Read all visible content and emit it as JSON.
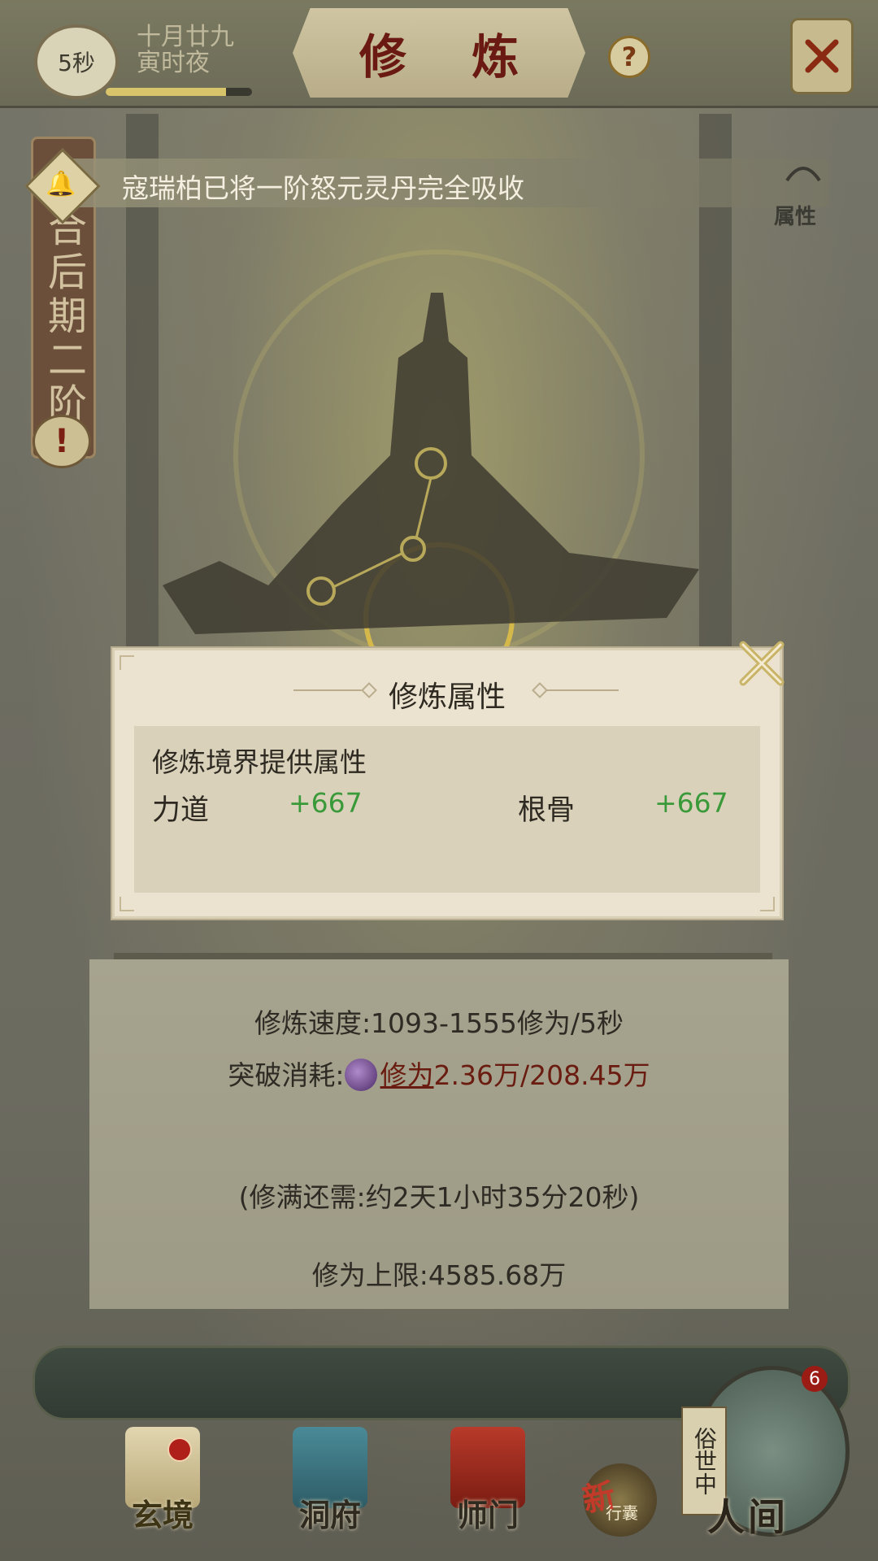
{
  "header": {
    "timer": "5秒",
    "date_line1": "十月廿九",
    "date_line2": "寅时夜",
    "title": "修 炼",
    "help_label": "?",
    "progress": 0.82
  },
  "realm": {
    "text": "融合后期二阶",
    "alert": "!"
  },
  "notification": {
    "text": "寇瑞柏已将一阶怒元灵丹完全吸收",
    "side_label": "属性"
  },
  "stats": {
    "speed": "修炼速度:1093-1555修为/5秒",
    "cost_prefix": "突破消耗:",
    "cost_resource": "修为",
    "cost_current": "2.36万",
    "cost_total": "/208.45万",
    "remaining": "(修满还需:约2天1小时35分20秒)",
    "limit": "修为上限:4585.68万"
  },
  "modal": {
    "title": "修炼属性",
    "section": "修炼境界提供属性",
    "attributes": [
      {
        "name": "力道",
        "value": "+667"
      },
      {
        "name": "根骨",
        "value": "+667"
      }
    ]
  },
  "nav": {
    "items": [
      {
        "label": "玄境"
      },
      {
        "label": "洞府"
      },
      {
        "label": "师门"
      }
    ],
    "bag_label": "行囊",
    "bag_new": "新",
    "world_tag": "俗世中",
    "world_label": "人间",
    "world_badge": "6"
  },
  "colors": {
    "accent_red": "#6a1c10",
    "attr_green": "#3a9a3a",
    "panel_bg": "#ebe3cf"
  }
}
